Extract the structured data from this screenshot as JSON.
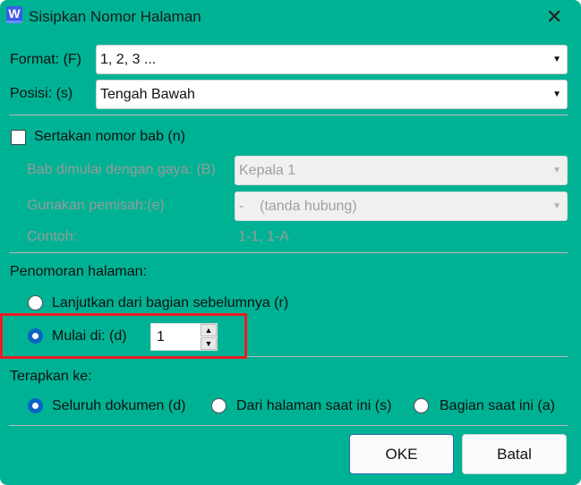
{
  "title": "Sisipkan Nomor Halaman",
  "app_icon": "W",
  "format": {
    "label": "Format: (F)",
    "value": "1, 2, 3 ..."
  },
  "position": {
    "label": "Posisi: (s)",
    "value": "Tengah Bawah"
  },
  "chapter": {
    "checkbox_label": "Sertakan nomor bab (n)",
    "checked": false,
    "style_label": "Bab dimulai dengan gaya: (B)",
    "style_value": "Kepala 1",
    "sep_label": "Gunakan pemisah:(e)",
    "sep_value": "-    (tanda hubung)",
    "example_label": "Contoh:",
    "example_value": "1-1, 1-A"
  },
  "numbering": {
    "heading": "Penomoran halaman:",
    "continue_label": "Lanjutkan dari bagian sebelumnya (r)",
    "start_label": "Mulai di: (d)",
    "start_value": "1",
    "up": "▲",
    "down": "▼"
  },
  "apply": {
    "heading": "Terapkan ke:",
    "options": [
      "Seluruh dokumen (d)",
      "Dari halaman saat ini (s)",
      "Bagian saat ini (a)"
    ]
  },
  "buttons": {
    "ok": "OKE",
    "cancel": "Batal"
  },
  "arrow": "▼",
  "close": "✕"
}
